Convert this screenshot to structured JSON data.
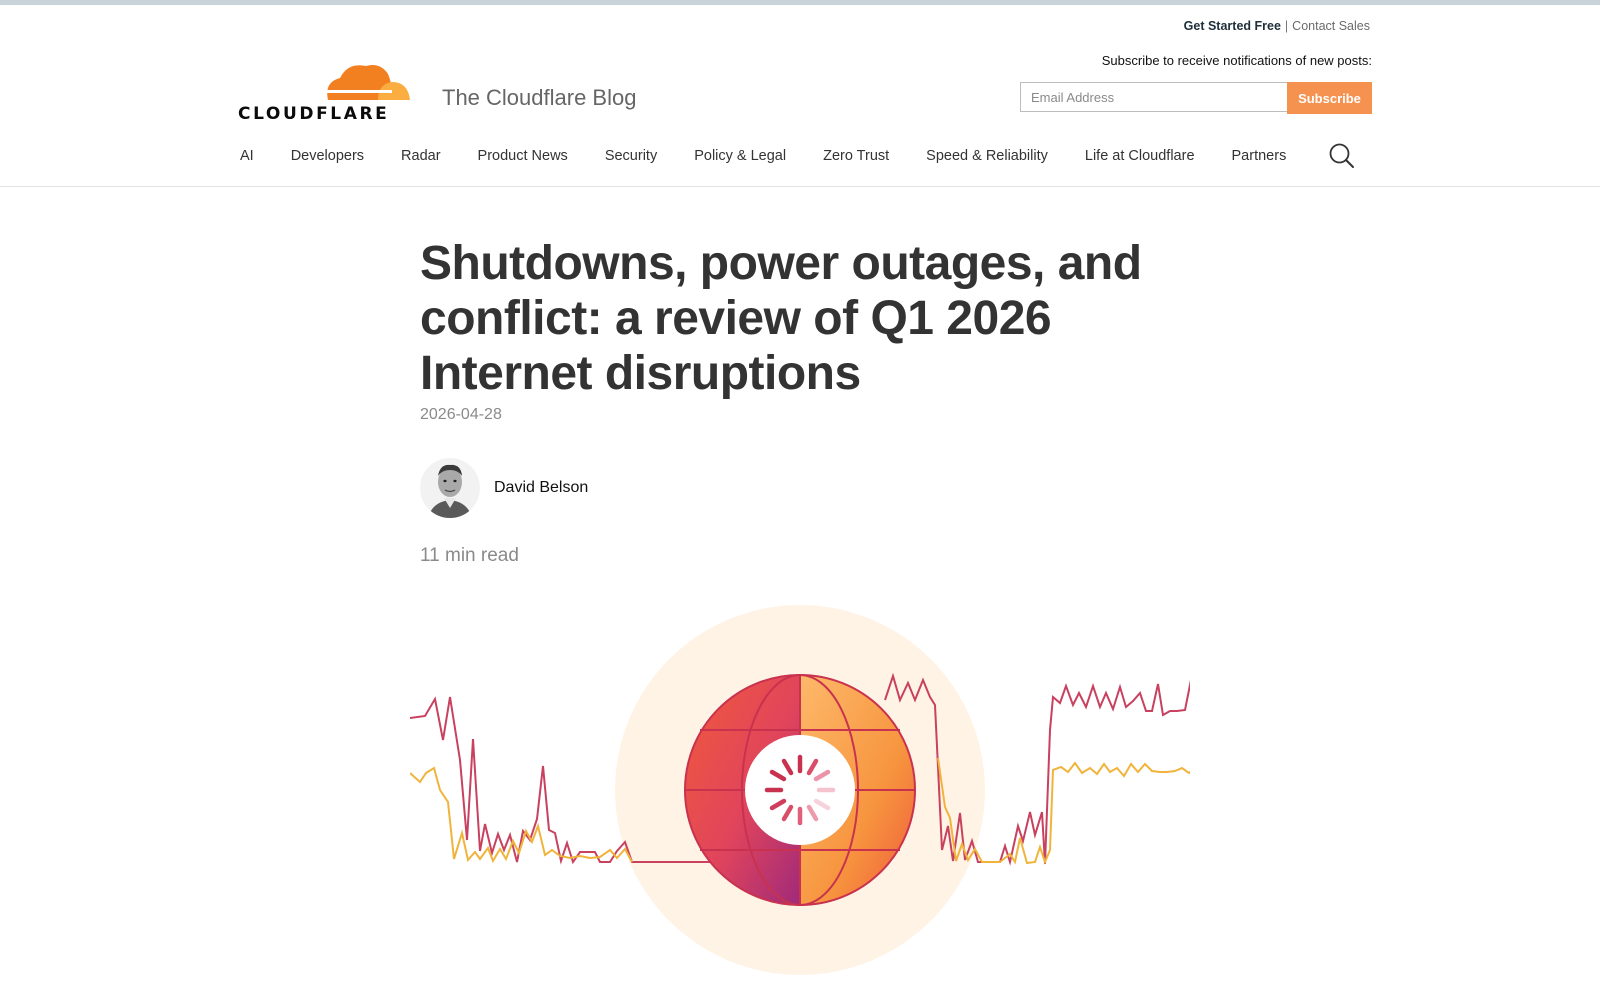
{
  "header": {
    "get_started": "Get Started Free",
    "separator": "|",
    "contact_sales": "Contact Sales",
    "logo_text": "CLOUDFLARE",
    "blog_title": "The Cloudflare Blog",
    "subscribe_label": "Subscribe to receive notifications of new posts:",
    "email_placeholder": "Email Address",
    "subscribe_button": "Subscribe"
  },
  "nav": {
    "items": [
      "AI",
      "Developers",
      "Radar",
      "Product News",
      "Security",
      "Policy & Legal",
      "Zero Trust",
      "Speed & Reliability",
      "Life at Cloudflare",
      "Partners"
    ],
    "search_icon": "search-icon"
  },
  "article": {
    "title": "Shutdowns, power outages, and conflict: a review of Q1 2026 Internet disruptions",
    "date": "2026-04-28",
    "author": "David Belson",
    "read_time": "11 min read"
  },
  "colors": {
    "accent_orange": "#f6924f",
    "logo_orange": "#f38020",
    "line_red": "#c8415f",
    "line_yellow": "#f0b43c"
  }
}
